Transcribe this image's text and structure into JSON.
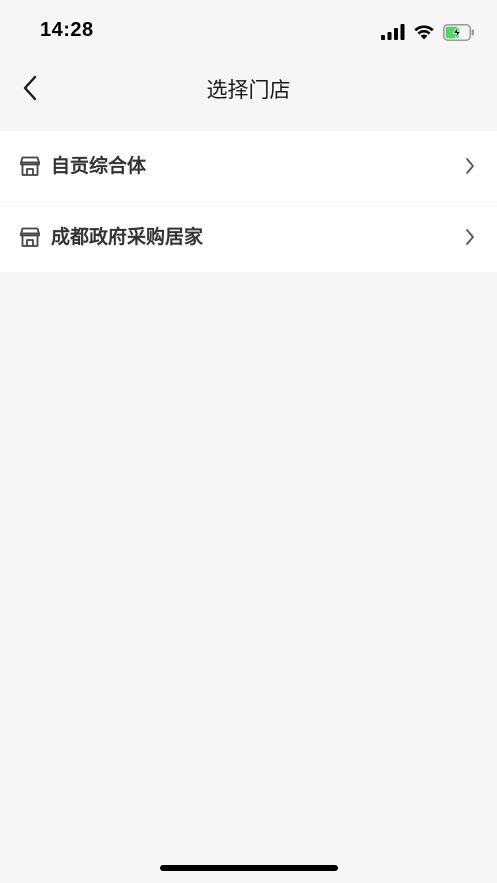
{
  "status_bar": {
    "time": "14:28",
    "icons": [
      "signal-icon",
      "wifi-icon",
      "battery-charging-icon"
    ],
    "battery_color": "#4cd964"
  },
  "nav": {
    "title": "选择门店",
    "back_icon": "chevron-left-icon"
  },
  "stores": [
    {
      "name": "自贡综合体",
      "icon": "store-icon",
      "arrow_icon": "chevron-right-icon"
    },
    {
      "name": "成都政府采购居家",
      "icon": "store-icon",
      "arrow_icon": "chevron-right-icon"
    }
  ],
  "colors": {
    "background": "#f6f6f6",
    "list_background": "#ffffff",
    "text_primary": "#333333",
    "title_text": "#1a1a1a",
    "chevron": "#555555"
  }
}
